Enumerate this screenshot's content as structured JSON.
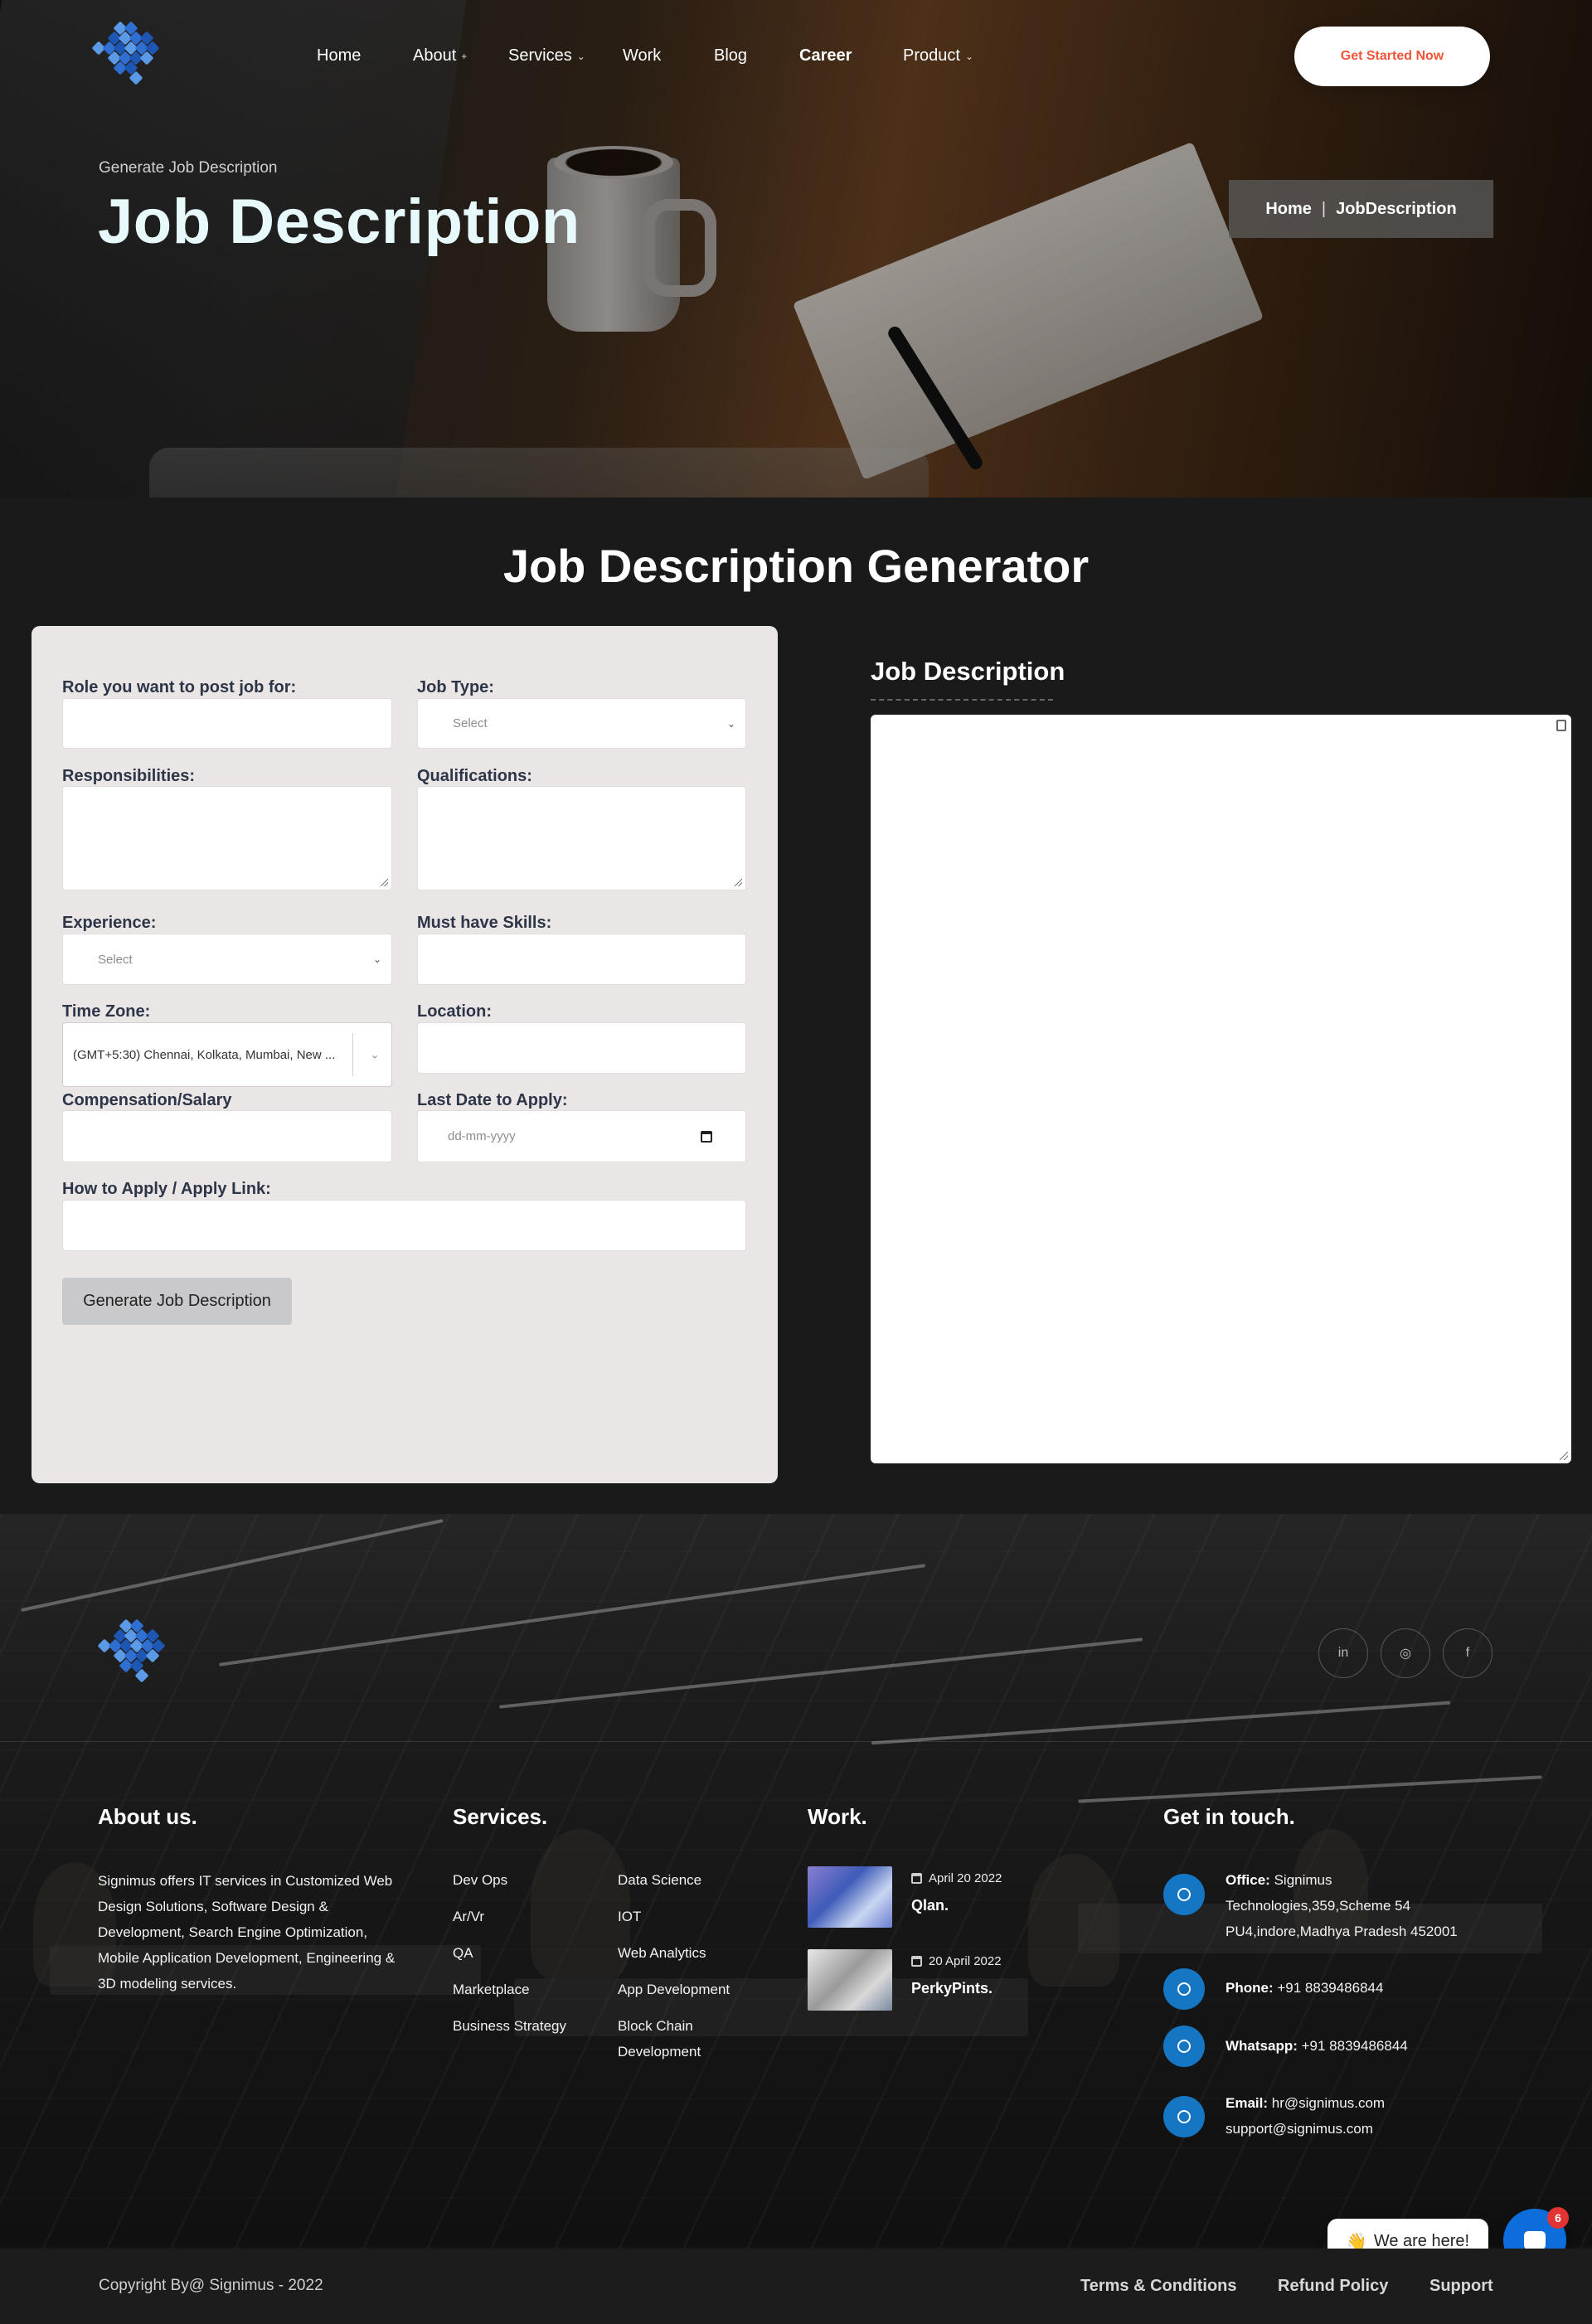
{
  "header": {
    "nav": [
      {
        "label": "Home",
        "has_menu": false
      },
      {
        "label": "About",
        "has_menu": true
      },
      {
        "label": "Services",
        "has_menu": true
      },
      {
        "label": "Work",
        "has_menu": false
      },
      {
        "label": "Blog",
        "has_menu": false
      },
      {
        "label": "Career",
        "has_menu": false,
        "active": true
      },
      {
        "label": "Product",
        "has_menu": true
      }
    ],
    "cta_label": "Get Started Now"
  },
  "hero": {
    "subtitle": "Generate Job Description",
    "title": "Job Description",
    "breadcrumb": {
      "home": "Home",
      "separator": "|",
      "current": "JobDescription"
    }
  },
  "generator": {
    "title": "Job Description Generator",
    "form": {
      "role_label": "Role you want to post job for:",
      "role_value": "",
      "job_type_label": "Job Type:",
      "job_type_value": "Select",
      "responsibilities_label": "Responsibilities:",
      "qualifications_label": "Qualifications:",
      "experience_label": "Experience:",
      "experience_value": "Select",
      "skills_label": "Must have Skills:",
      "timezone_label": "Time Zone:",
      "timezone_value": "(GMT+5:30) Chennai, Kolkata, Mumbai, New ...",
      "location_label": "Location:",
      "salary_label": "Compensation/Salary",
      "last_date_label": "Last Date to Apply:",
      "last_date_placeholder": "dd-mm-yyyy",
      "apply_label": "How to Apply / Apply Link:",
      "submit_label": "Generate Job Description"
    },
    "output": {
      "title": "Job Description",
      "value": ""
    }
  },
  "footer": {
    "social_icons": [
      "linkedin-icon",
      "instagram-icon",
      "facebook-icon"
    ],
    "about": {
      "title": "About us.",
      "text": "Signimus offers IT services in Customized Web Design Solutions, Software Design & Development, Search Engine Optimization, Mobile Application Development, Engineering & 3D modeling services."
    },
    "services": {
      "title": "Services.",
      "col1": [
        "Dev Ops",
        "Ar/Vr",
        "QA",
        "Marketplace",
        "Business Strategy"
      ],
      "col2": [
        "Data Science",
        "IOT",
        "Web Analytics",
        "App Development",
        "Block Chain Development"
      ]
    },
    "work": {
      "title": "Work.",
      "items": [
        {
          "date": "April 20 2022",
          "name": "Qlan."
        },
        {
          "date": "20 April 2022",
          "name": "PerkyPints."
        }
      ]
    },
    "contact": {
      "title": "Get in touch.",
      "office_label": "Office:",
      "office_value": "Signimus Technologies,359,Scheme 54 PU4,indore,Madhya Pradesh 452001",
      "phone_label": "Phone:",
      "phone_value": "+91 8839486844",
      "whatsapp_label": "Whatsapp:",
      "whatsapp_value": "+91 8839486844",
      "email_label": "Email:",
      "email_value_1": "hr@signimus.com",
      "email_value_2": "support@signimus.com"
    },
    "chat": {
      "bubble_text": "We are here!",
      "emoji": "👋",
      "badge_count": "6"
    },
    "copyright": "Copyright By@ Signimus - 2022",
    "links": [
      "Terms & Conditions",
      "Refund Policy",
      "Support"
    ]
  },
  "colors": {
    "accent": "#f0553a",
    "brand_blue": "#1576c4",
    "chat_blue": "#0d6edb"
  }
}
